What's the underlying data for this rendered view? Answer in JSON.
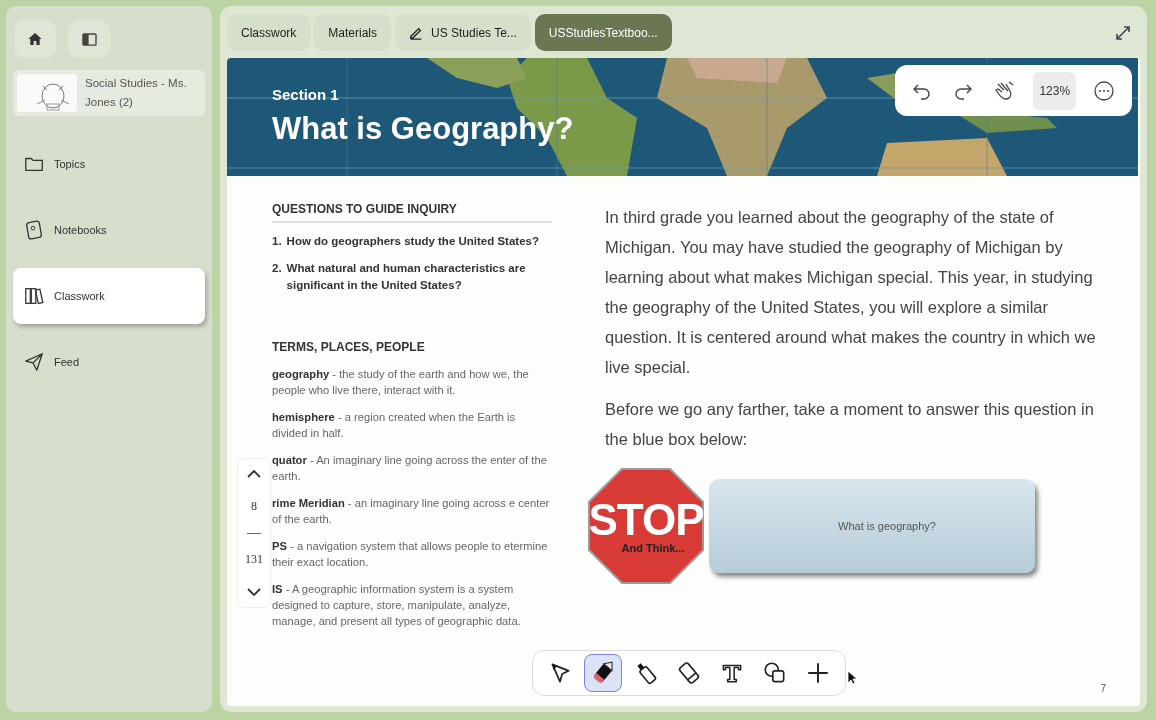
{
  "sidebar": {
    "course": {
      "title": "Social Studies - Ms. Jones (2)"
    },
    "items": [
      {
        "label": "Topics",
        "selected": false
      },
      {
        "label": "Notebooks",
        "selected": false
      },
      {
        "label": "Classwork",
        "selected": true
      },
      {
        "label": "Feed",
        "selected": false
      }
    ]
  },
  "breadcrumbs": [
    {
      "label": "Classwork",
      "kind": "plain",
      "selected": false
    },
    {
      "label": "Materials",
      "kind": "plain",
      "selected": false
    },
    {
      "label": "US Studies Te...",
      "kind": "notebook",
      "selected": false
    },
    {
      "label": "USStudiesTextboo...",
      "kind": "plain",
      "selected": true
    }
  ],
  "view_toolbar": {
    "zoom": "123%"
  },
  "document": {
    "section": "Section 1",
    "title": "What is Geography?",
    "questions_heading": "QUESTIONS TO GUIDE INQUIRY",
    "questions": [
      {
        "number": "1.",
        "text": "How do geographers study the United States?"
      },
      {
        "number": "2.",
        "text": "What natural and human characteristics are significant in the United States?"
      }
    ],
    "terms_heading": "TERMS, PLACES, PEOPLE",
    "terms": [
      "**geography** - the study of the earth and how we, the people who live there, interact with it.",
      "**hemisphere** - a region created when the Earth is divided in half.",
      "**quator** - An imaginary line going across the enter of the earth.",
      "**rime Meridian** - an imaginary line going across e center of the earth.",
      "**PS** - a navigation system that allows people to etermine their exact location.",
      "**IS** - A geographic information system is a system designed to capture, store, manipulate, analyze, manage, and present all types of geographic data."
    ],
    "paragraphs": [
      "In third grade you learned about the geography of the state of Michigan.  You may have studied the geography of Michigan by learning about what makes Michigan special.  This year, in studying the geography of the United States, you will explore a similar question.  It is centered around what makes the country in which we live special.",
      "Before we go any farther, take a moment to answer this question in the blue box below:"
    ],
    "stop_sign": {
      "word": "STOP",
      "caption": "And Think..."
    },
    "question_box": "What is geography?",
    "page_number": "7"
  },
  "page_navigator": {
    "current": "8",
    "total": "131"
  },
  "tools": [
    {
      "kind": "pointer",
      "selected": false
    },
    {
      "kind": "pen",
      "selected": true
    },
    {
      "kind": "highlighter",
      "selected": false
    },
    {
      "kind": "eraser",
      "selected": false
    },
    {
      "kind": "text",
      "selected": false
    },
    {
      "kind": "shapes",
      "selected": false
    },
    {
      "kind": "add",
      "selected": false
    }
  ]
}
